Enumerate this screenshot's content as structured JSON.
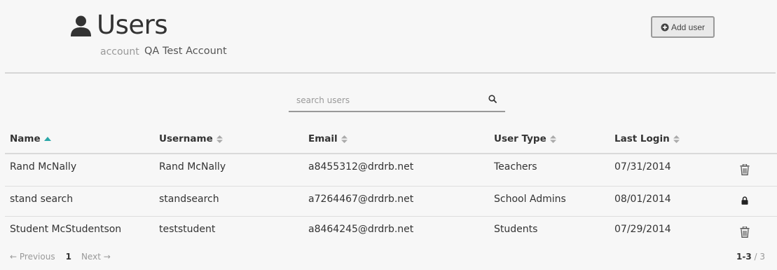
{
  "header": {
    "title": "Users",
    "account_label": "account",
    "account_name": "QA Test Account",
    "add_user_label": "Add user"
  },
  "search": {
    "placeholder": "search users",
    "value": ""
  },
  "table": {
    "columns": [
      {
        "label": "Name",
        "sort": "asc"
      },
      {
        "label": "Username",
        "sort": "none"
      },
      {
        "label": "Email",
        "sort": "none"
      },
      {
        "label": "User Type",
        "sort": "none"
      },
      {
        "label": "Last Login",
        "sort": "none"
      }
    ],
    "rows": [
      {
        "name": "Rand McNally",
        "username": "Rand McNally",
        "email": "a8455312@drdrb.net",
        "user_type": "Teachers",
        "last_login": "07/31/2014",
        "action_icon": "trash-icon"
      },
      {
        "name": "stand search",
        "username": "standsearch",
        "email": "a7264467@drdrb.net",
        "user_type": "School Admins",
        "last_login": "08/01/2014",
        "action_icon": "lock-icon"
      },
      {
        "name": "Student McStudentson",
        "username": "teststudent",
        "email": "a8464245@drdrb.net",
        "user_type": "Students",
        "last_login": "07/29/2014",
        "action_icon": "trash-icon"
      }
    ]
  },
  "pagination": {
    "previous_label": "← Previous",
    "current_page": "1",
    "next_label": "Next →",
    "range": "1-3",
    "total": "/ 3"
  },
  "colors": {
    "accent": "#2aa7a8",
    "sort_neutral": "#aaaaaa"
  }
}
